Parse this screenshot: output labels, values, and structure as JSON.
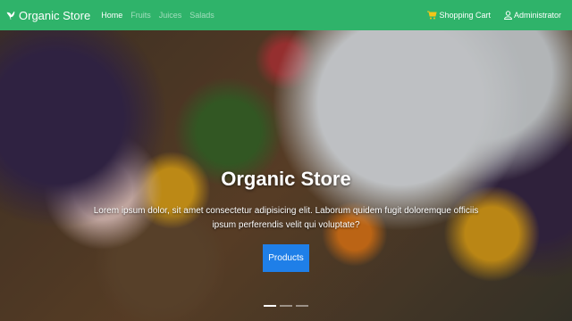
{
  "navbar": {
    "brand": "Organic Store",
    "links": [
      {
        "label": "Home",
        "active": true
      },
      {
        "label": "Fruits",
        "active": false
      },
      {
        "label": "Juices",
        "active": false
      },
      {
        "label": "Salads",
        "active": false
      }
    ],
    "cart_label": "Shopping Cart",
    "user_label": "Administrator",
    "color": "#2fb36a"
  },
  "hero": {
    "title": "Organic Store",
    "text": "Lorem ipsum dolor, sit amet consectetur adipisicing elit. Laborum quidem fugit doloremque officiis ipsum perferendis velit qui voluptate?",
    "button_label": "Products",
    "button_color": "#1f7fe8",
    "slide_count": 3,
    "active_slide": 1
  },
  "icons": {
    "brand": "leaf-icon",
    "cart": "cart-icon",
    "user": "user-icon"
  }
}
